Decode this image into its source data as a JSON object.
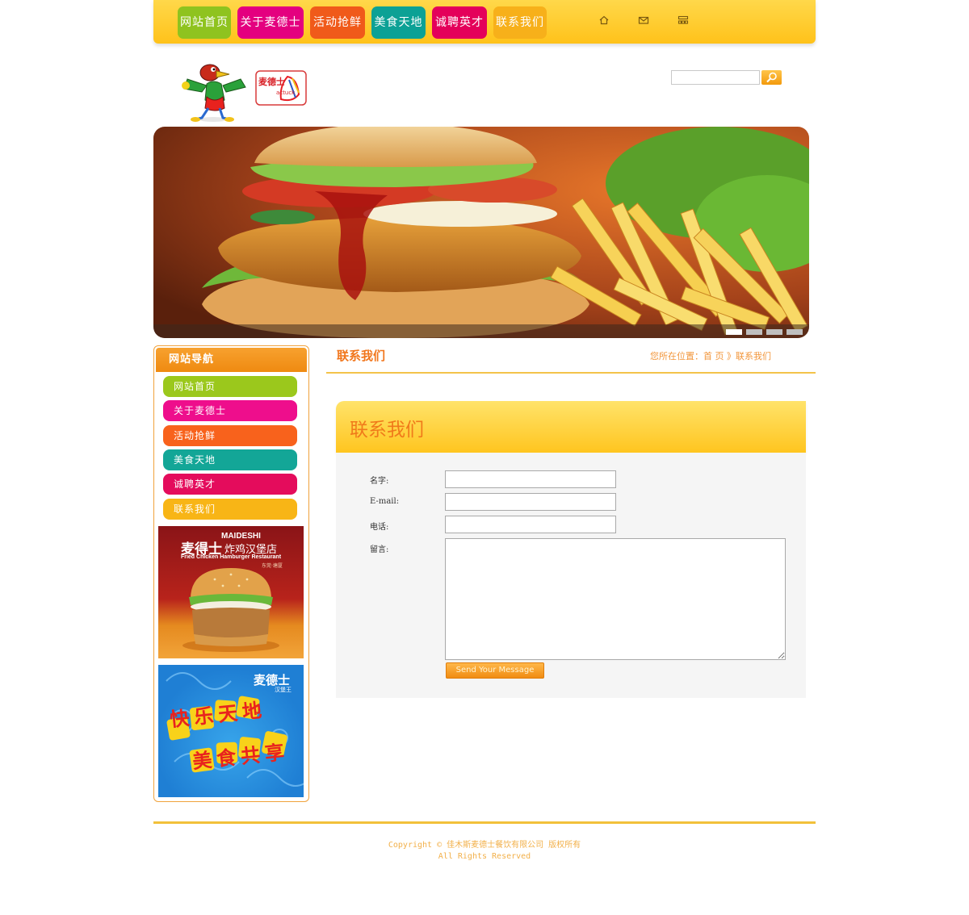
{
  "nav": {
    "items": [
      {
        "label": "网站首页",
        "color": "#8fc31f"
      },
      {
        "label": "关于麦德士",
        "color": "#e4007f"
      },
      {
        "label": "活动抢鲜",
        "color": "#f05a1a"
      },
      {
        "label": "美食天地",
        "color": "#0ca195"
      },
      {
        "label": "诚聘英才",
        "color": "#e4005a"
      },
      {
        "label": "联系我们",
        "color": "#f7b01a"
      }
    ],
    "icons": [
      "home-icon",
      "mail-icon",
      "sitemap-icon"
    ]
  },
  "brand": {
    "logo_text": "麦德士",
    "logo_sub": "actuck",
    "mascot": "cartoon-bird-mascot"
  },
  "search": {
    "placeholder": "",
    "button_icon": "search-icon"
  },
  "banner": {
    "subject": "burger-and-fries",
    "slides": 4,
    "active_slide": 1
  },
  "sidebar": {
    "title": "网站导航",
    "items": [
      {
        "label": "网站首页",
        "color": "#9bc81c"
      },
      {
        "label": "关于麦德士",
        "color": "#ee0e8c"
      },
      {
        "label": "活动抢鲜",
        "color": "#f8621c"
      },
      {
        "label": "美食天地",
        "color": "#13a697"
      },
      {
        "label": "诚聘英才",
        "color": "#e40c5c"
      },
      {
        "label": "联系我们",
        "color": "#f8b516"
      }
    ],
    "ad1": {
      "title": "麦得士",
      "title2": "炸鸡汉堡店",
      "en_brand": "MAIDESHI",
      "subtitle": "Fried Chicken Hamburger Restaurant",
      "note": "东莞·塘厦"
    },
    "ad2": {
      "logo": "麦德士",
      "logo_sub": "汉堡王",
      "line1": "快乐天地",
      "line2": "美食共享"
    }
  },
  "main": {
    "title": "联系我们",
    "breadcrumb": {
      "prefix": "您所在位置：",
      "home": "首 页",
      "sep": "》",
      "current": "联系我们"
    },
    "panel_title": "联系我们",
    "form": {
      "name_label": "名字:",
      "email_label": "E-mail:",
      "phone_label": "电话:",
      "message_label": "留言:",
      "name_value": "",
      "email_value": "",
      "phone_value": "",
      "message_value": "",
      "submit_label": "Send Your Message"
    }
  },
  "footer": {
    "copyright": "Copyright © 佳木斯麦德士餐饮有限公司 版权所有",
    "rights": "All Rights Reserved"
  },
  "colors": {
    "accent": "#f7a12f",
    "title": "#f1761c",
    "bar": "#ffc21a"
  }
}
